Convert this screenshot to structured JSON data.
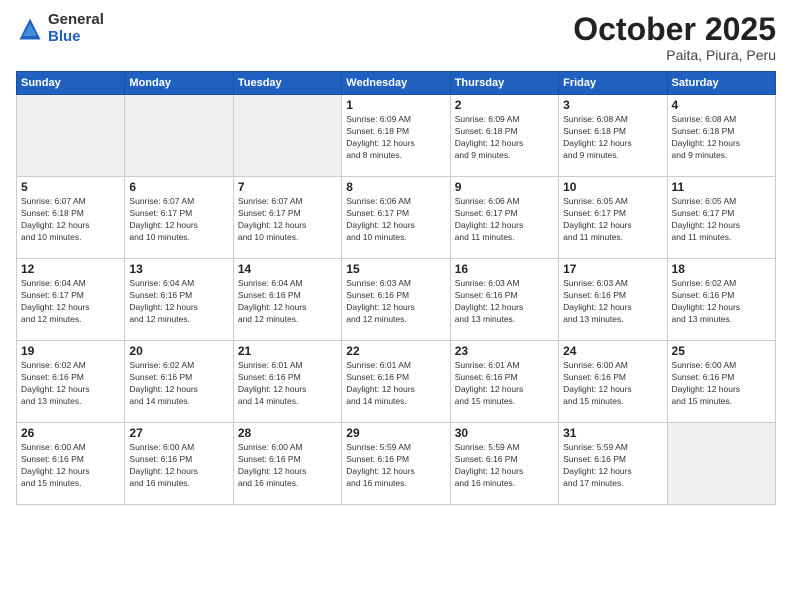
{
  "header": {
    "logo_general": "General",
    "logo_blue": "Blue",
    "title": "October 2025",
    "location": "Paita, Piura, Peru"
  },
  "days_of_week": [
    "Sunday",
    "Monday",
    "Tuesday",
    "Wednesday",
    "Thursday",
    "Friday",
    "Saturday"
  ],
  "weeks": [
    [
      {
        "day": "",
        "text": ""
      },
      {
        "day": "",
        "text": ""
      },
      {
        "day": "",
        "text": ""
      },
      {
        "day": "1",
        "text": "Sunrise: 6:09 AM\nSunset: 6:18 PM\nDaylight: 12 hours\nand 8 minutes."
      },
      {
        "day": "2",
        "text": "Sunrise: 6:09 AM\nSunset: 6:18 PM\nDaylight: 12 hours\nand 9 minutes."
      },
      {
        "day": "3",
        "text": "Sunrise: 6:08 AM\nSunset: 6:18 PM\nDaylight: 12 hours\nand 9 minutes."
      },
      {
        "day": "4",
        "text": "Sunrise: 6:08 AM\nSunset: 6:18 PM\nDaylight: 12 hours\nand 9 minutes."
      }
    ],
    [
      {
        "day": "5",
        "text": "Sunrise: 6:07 AM\nSunset: 6:18 PM\nDaylight: 12 hours\nand 10 minutes."
      },
      {
        "day": "6",
        "text": "Sunrise: 6:07 AM\nSunset: 6:17 PM\nDaylight: 12 hours\nand 10 minutes."
      },
      {
        "day": "7",
        "text": "Sunrise: 6:07 AM\nSunset: 6:17 PM\nDaylight: 12 hours\nand 10 minutes."
      },
      {
        "day": "8",
        "text": "Sunrise: 6:06 AM\nSunset: 6:17 PM\nDaylight: 12 hours\nand 10 minutes."
      },
      {
        "day": "9",
        "text": "Sunrise: 6:06 AM\nSunset: 6:17 PM\nDaylight: 12 hours\nand 11 minutes."
      },
      {
        "day": "10",
        "text": "Sunrise: 6:05 AM\nSunset: 6:17 PM\nDaylight: 12 hours\nand 11 minutes."
      },
      {
        "day": "11",
        "text": "Sunrise: 6:05 AM\nSunset: 6:17 PM\nDaylight: 12 hours\nand 11 minutes."
      }
    ],
    [
      {
        "day": "12",
        "text": "Sunrise: 6:04 AM\nSunset: 6:17 PM\nDaylight: 12 hours\nand 12 minutes."
      },
      {
        "day": "13",
        "text": "Sunrise: 6:04 AM\nSunset: 6:16 PM\nDaylight: 12 hours\nand 12 minutes."
      },
      {
        "day": "14",
        "text": "Sunrise: 6:04 AM\nSunset: 6:16 PM\nDaylight: 12 hours\nand 12 minutes."
      },
      {
        "day": "15",
        "text": "Sunrise: 6:03 AM\nSunset: 6:16 PM\nDaylight: 12 hours\nand 12 minutes."
      },
      {
        "day": "16",
        "text": "Sunrise: 6:03 AM\nSunset: 6:16 PM\nDaylight: 12 hours\nand 13 minutes."
      },
      {
        "day": "17",
        "text": "Sunrise: 6:03 AM\nSunset: 6:16 PM\nDaylight: 12 hours\nand 13 minutes."
      },
      {
        "day": "18",
        "text": "Sunrise: 6:02 AM\nSunset: 6:16 PM\nDaylight: 12 hours\nand 13 minutes."
      }
    ],
    [
      {
        "day": "19",
        "text": "Sunrise: 6:02 AM\nSunset: 6:16 PM\nDaylight: 12 hours\nand 13 minutes."
      },
      {
        "day": "20",
        "text": "Sunrise: 6:02 AM\nSunset: 6:16 PM\nDaylight: 12 hours\nand 14 minutes."
      },
      {
        "day": "21",
        "text": "Sunrise: 6:01 AM\nSunset: 6:16 PM\nDaylight: 12 hours\nand 14 minutes."
      },
      {
        "day": "22",
        "text": "Sunrise: 6:01 AM\nSunset: 6:16 PM\nDaylight: 12 hours\nand 14 minutes."
      },
      {
        "day": "23",
        "text": "Sunrise: 6:01 AM\nSunset: 6:16 PM\nDaylight: 12 hours\nand 15 minutes."
      },
      {
        "day": "24",
        "text": "Sunrise: 6:00 AM\nSunset: 6:16 PM\nDaylight: 12 hours\nand 15 minutes."
      },
      {
        "day": "25",
        "text": "Sunrise: 6:00 AM\nSunset: 6:16 PM\nDaylight: 12 hours\nand 15 minutes."
      }
    ],
    [
      {
        "day": "26",
        "text": "Sunrise: 6:00 AM\nSunset: 6:16 PM\nDaylight: 12 hours\nand 15 minutes."
      },
      {
        "day": "27",
        "text": "Sunrise: 6:00 AM\nSunset: 6:16 PM\nDaylight: 12 hours\nand 16 minutes."
      },
      {
        "day": "28",
        "text": "Sunrise: 6:00 AM\nSunset: 6:16 PM\nDaylight: 12 hours\nand 16 minutes."
      },
      {
        "day": "29",
        "text": "Sunrise: 5:59 AM\nSunset: 6:16 PM\nDaylight: 12 hours\nand 16 minutes."
      },
      {
        "day": "30",
        "text": "Sunrise: 5:59 AM\nSunset: 6:16 PM\nDaylight: 12 hours\nand 16 minutes."
      },
      {
        "day": "31",
        "text": "Sunrise: 5:59 AM\nSunset: 6:16 PM\nDaylight: 12 hours\nand 17 minutes."
      },
      {
        "day": "",
        "text": ""
      }
    ]
  ]
}
